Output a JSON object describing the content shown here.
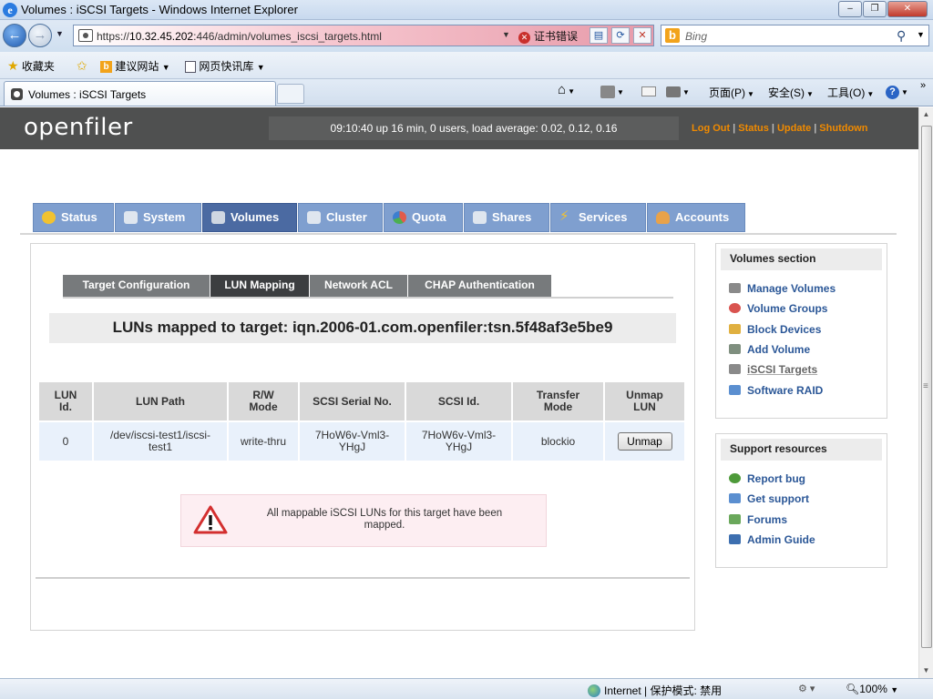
{
  "window": {
    "title": "Volumes : iSCSI Targets - Windows Internet Explorer",
    "min_label": "–",
    "max_label": "❐",
    "close_label": "✕"
  },
  "addressbar": {
    "url_prefix": "https://",
    "url_host": "10.32.45.202",
    "url_rest": ":446/admin/volumes_iscsi_targets.html",
    "cert_error": "证书错误",
    "search_placeholder": "Bing"
  },
  "favorites": {
    "favorites_label": "收藏夹",
    "suggested_sites": "建议网站",
    "web_slice_gallery": "网页快讯库"
  },
  "tabs": {
    "active_tab": "Volumes : iSCSI Targets"
  },
  "commandbar": {
    "page": "页面(P)",
    "safety": "安全(S)",
    "tools": "工具(O)"
  },
  "openfiler": {
    "logo": "openfiler",
    "uptime": "09:10:40 up 16 min, 0 users, load average: 0.02, 0.12, 0.16",
    "links": [
      "Log Out",
      "Status",
      "Update",
      "Shutdown"
    ]
  },
  "main_tabs": [
    {
      "label": "Status",
      "icon": "sun-icon",
      "color": "#f2c230",
      "active": false
    },
    {
      "label": "System",
      "icon": "monitor-icon",
      "color": "#dfe6ef",
      "active": false
    },
    {
      "label": "Volumes",
      "icon": "disk-icon",
      "color": "#cfd7e2",
      "active": true
    },
    {
      "label": "Cluster",
      "icon": "cluster-icon",
      "color": "#dfe6ef",
      "active": false
    },
    {
      "label": "Quota",
      "icon": "pie-icon",
      "color": "#e25b4b",
      "active": false
    },
    {
      "label": "Shares",
      "icon": "shares-icon",
      "color": "#dfe6ef",
      "active": false
    },
    {
      "label": "Services",
      "icon": "lightning-icon",
      "color": "#f2c230",
      "active": false
    },
    {
      "label": "Accounts",
      "icon": "accounts-icon",
      "color": "#e8a24a",
      "active": false
    }
  ],
  "sub_tabs": [
    {
      "label": "Target Configuration",
      "active": false
    },
    {
      "label": "LUN Mapping",
      "active": true
    },
    {
      "label": "Network ACL",
      "active": false
    },
    {
      "label": "CHAP Authentication",
      "active": false
    }
  ],
  "heading": "LUNs mapped to target: iqn.2006-01.com.openfiler:tsn.5f48af3e5be9",
  "lun_table": {
    "headers": [
      [
        "LUN",
        "Id."
      ],
      [
        "LUN Path"
      ],
      [
        "R/W",
        "Mode"
      ],
      [
        "SCSI Serial No."
      ],
      [
        "SCSI Id."
      ],
      [
        "Transfer",
        "Mode"
      ],
      [
        "Unmap",
        "LUN"
      ]
    ],
    "rows": [
      {
        "id": "0",
        "path": [
          "/dev/iscsi-test1/iscsi-",
          "test1"
        ],
        "rw_mode": "write-thru",
        "serial": [
          "7HoW6v-Vml3-",
          "YHgJ"
        ],
        "scsi_id": [
          "7HoW6v-Vml3-",
          "YHgJ"
        ],
        "transfer_mode": "blockio",
        "unmap_label": "Unmap"
      }
    ]
  },
  "notice": "All mappable iSCSI LUNs for this target have been mapped.",
  "volumes_section": {
    "title": "Volumes section",
    "items": [
      {
        "label": "Manage Volumes",
        "icon": "manage-volumes-icon",
        "color": "#8a8a8a",
        "current": false
      },
      {
        "label": "Volume Groups",
        "icon": "volume-groups-icon",
        "color": "#d9534f",
        "current": false
      },
      {
        "label": "Block Devices",
        "icon": "block-devices-icon",
        "color": "#e0b040",
        "current": false
      },
      {
        "label": "Add Volume",
        "icon": "add-volume-icon",
        "color": "#7f8f7f",
        "current": false
      },
      {
        "label": "iSCSI Targets",
        "icon": "iscsi-targets-icon",
        "color": "#8a8a8a",
        "current": true
      },
      {
        "label": "Software RAID",
        "icon": "software-raid-icon",
        "color": "#5b8fd0",
        "current": false
      }
    ]
  },
  "support_resources": {
    "title": "Support resources",
    "items": [
      {
        "label": "Report bug",
        "icon": "bug-icon",
        "color": "#4e9a3a"
      },
      {
        "label": "Get support",
        "icon": "support-icon",
        "color": "#5b8fd0"
      },
      {
        "label": "Forums",
        "icon": "forums-icon",
        "color": "#6aa85b"
      },
      {
        "label": "Admin Guide",
        "icon": "guide-icon",
        "color": "#3d6fb0"
      }
    ]
  },
  "statusbar": {
    "zone": "Internet | 保护模式: 禁用",
    "zoom": "100%"
  }
}
